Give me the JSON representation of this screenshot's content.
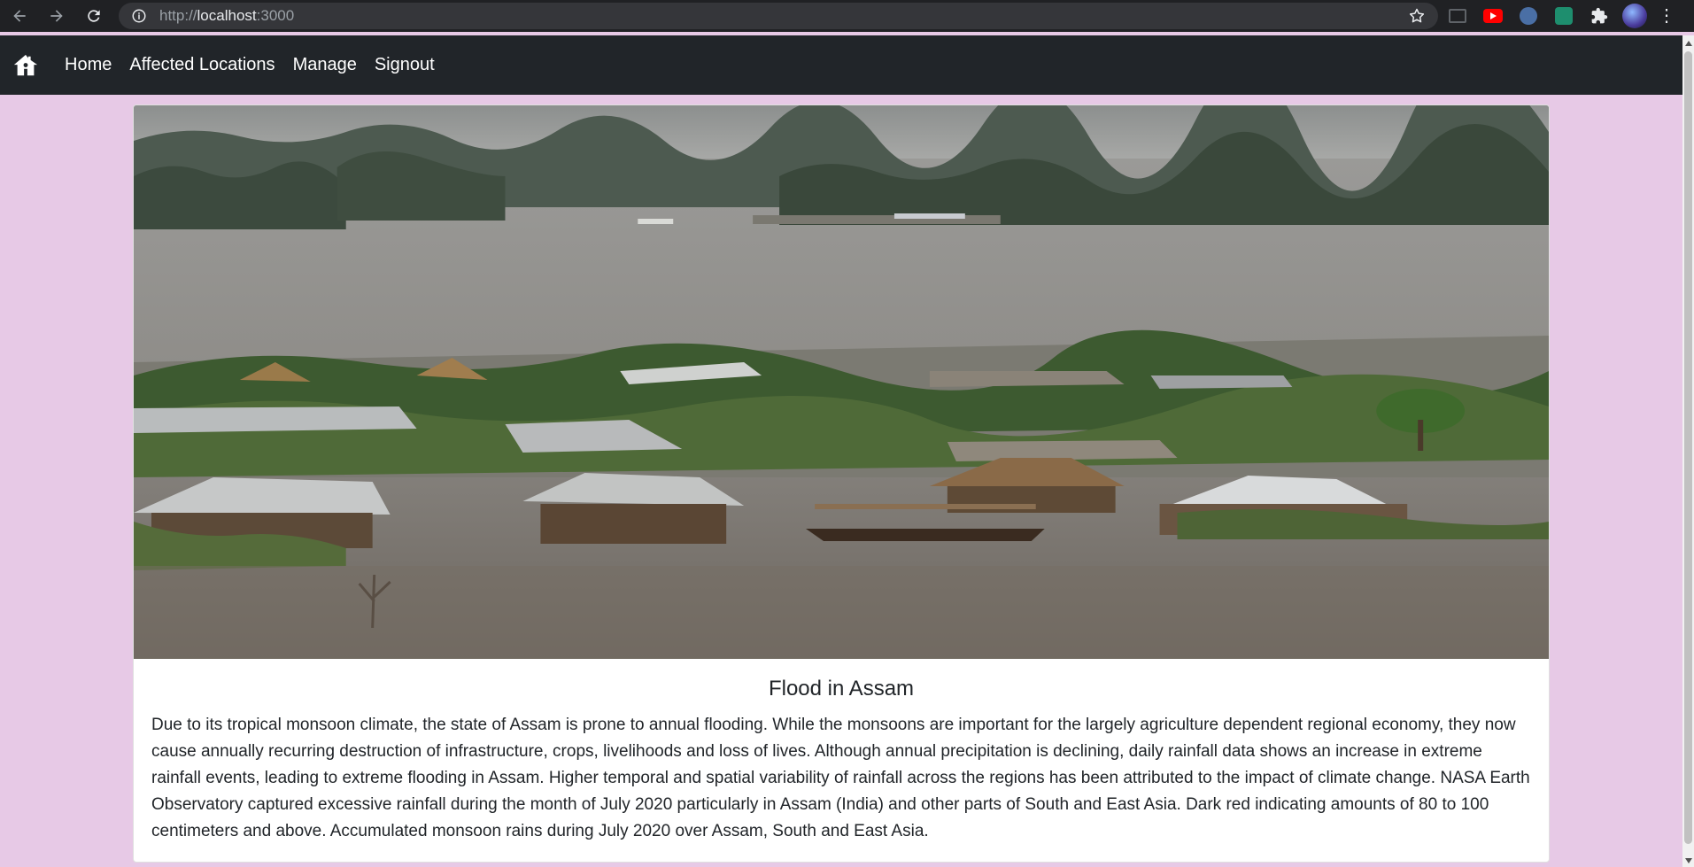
{
  "browser": {
    "url_prefix": "http://",
    "url_host": "localhost",
    "url_port": ":3000"
  },
  "navbar": {
    "links": [
      "Home",
      "Affected Locations",
      "Manage",
      "Signout"
    ]
  },
  "card": {
    "title": "Flood in Assam",
    "text": "Due to its tropical monsoon climate, the state of Assam is prone to annual flooding. While the monsoons are important for the largely agriculture dependent regional economy, they now cause annually recurring destruction of infrastructure, crops, livelihoods and loss of lives. Although annual precipitation is declining, daily rainfall data shows an increase in extreme rainfall events, leading to extreme flooding in Assam. Higher temporal and spatial variability of rainfall across the regions has been attributed to the impact of climate change. NASA Earth Observatory captured excessive rainfall during the month of July 2020 particularly in Assam (India) and other parts of South and East Asia. Dark red indicating amounts of 80 to 100 centimeters and above. Accumulated monsoon rains during July 2020 over Assam, South and East Asia."
  },
  "colors": {
    "page_background": "#e7c9e6",
    "navbar_background": "#212529",
    "browser_chrome": "#202124"
  },
  "icons": [
    "back-arrow-icon",
    "forward-arrow-icon",
    "reload-icon",
    "info-icon",
    "star-icon",
    "extensions-icon",
    "home-icon"
  ]
}
